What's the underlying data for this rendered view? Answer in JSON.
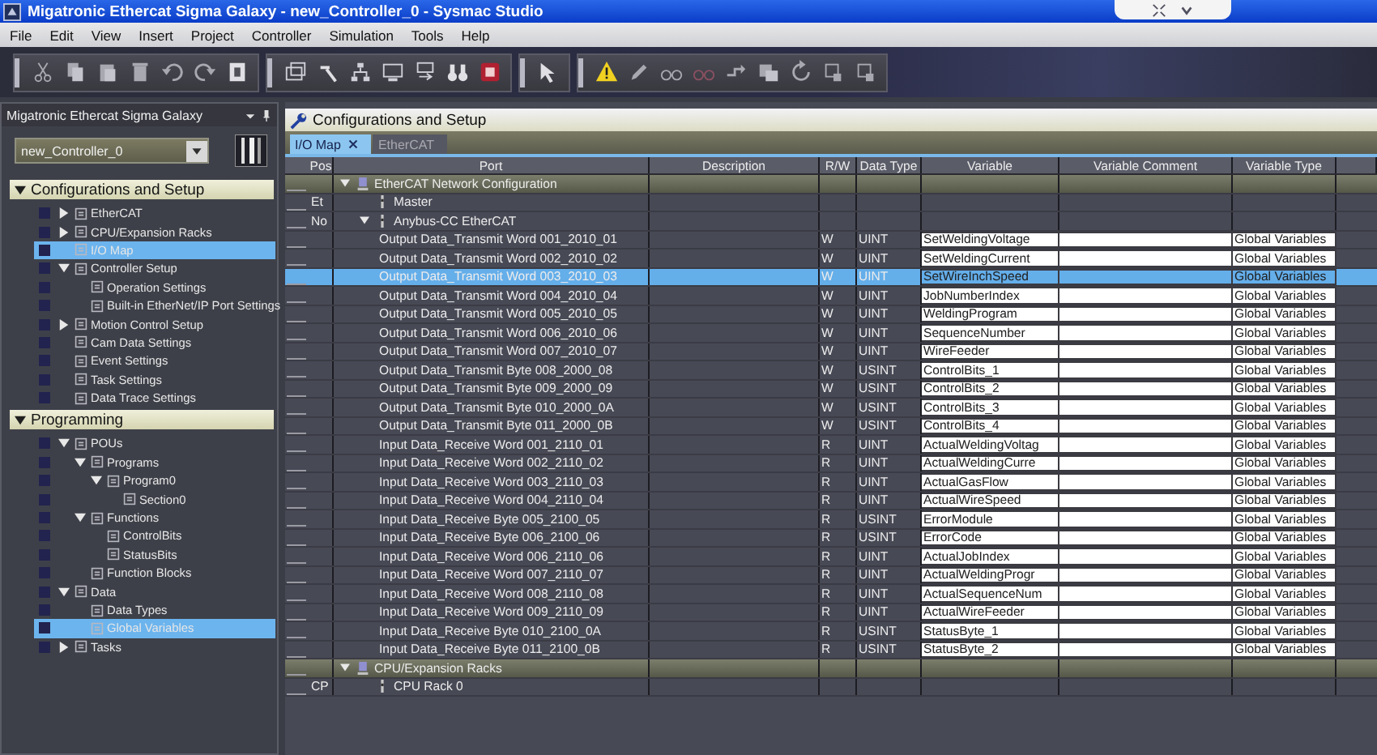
{
  "window": {
    "title": "Migatronic Ethercat Sigma Galaxy - new_Controller_0 - Sysmac Studio"
  },
  "menu": [
    "File",
    "Edit",
    "View",
    "Insert",
    "Project",
    "Controller",
    "Simulation",
    "Tools",
    "Help"
  ],
  "sidebar": {
    "title": "Migatronic Ethercat Sigma Galaxy",
    "controller": "new_Controller_0",
    "sections": [
      {
        "label": "Configurations and Setup",
        "expanded": true,
        "items": [
          {
            "label": "EtherCAT",
            "expanded": false,
            "selected": false
          },
          {
            "label": "CPU/Expansion Racks",
            "expanded": false,
            "selected": false
          },
          {
            "label": "I/O Map",
            "selected": true
          },
          {
            "label": "Controller Setup",
            "expanded": true,
            "selected": false,
            "children": [
              {
                "label": "Operation Settings",
                "selected": false
              },
              {
                "label": "Built-in EtherNet/IP Port Settings",
                "selected": false
              }
            ]
          },
          {
            "label": "Motion Control Setup",
            "expanded": false,
            "selected": false
          },
          {
            "label": "Cam Data Settings",
            "selected": false
          },
          {
            "label": "Event Settings",
            "selected": false
          },
          {
            "label": "Task Settings",
            "selected": false
          },
          {
            "label": "Data Trace Settings",
            "selected": false
          }
        ]
      },
      {
        "label": "Programming",
        "expanded": true,
        "items": [
          {
            "label": "POUs",
            "expanded": true,
            "selected": false,
            "children": [
              {
                "label": "Programs",
                "expanded": true,
                "selected": false,
                "children": [
                  {
                    "label": "Program0",
                    "expanded": true,
                    "selected": false,
                    "children": [
                      {
                        "label": "Section0",
                        "selected": false
                      }
                    ]
                  }
                ]
              },
              {
                "label": "Functions",
                "expanded": true,
                "selected": false,
                "children": [
                  {
                    "label": "ControlBits",
                    "selected": false
                  },
                  {
                    "label": "StatusBits",
                    "selected": false
                  }
                ]
              },
              {
                "label": "Function Blocks",
                "selected": false
              }
            ]
          },
          {
            "label": "Data",
            "expanded": true,
            "selected": false,
            "children": [
              {
                "label": "Data Types",
                "selected": false
              },
              {
                "label": "Global Variables",
                "selected": true
              }
            ]
          },
          {
            "label": "Tasks",
            "expanded": false,
            "selected": false
          }
        ]
      }
    ]
  },
  "editor": {
    "title": "Configurations and Setup",
    "tabs": [
      {
        "label": "I/O Map",
        "selected": true,
        "closable": true
      },
      {
        "label": "EtherCAT",
        "selected": false
      }
    ],
    "table": {
      "columns": [
        "Pos",
        "Port",
        "Description",
        "R/W",
        "Data Type",
        "Variable",
        "Variable Comment",
        "Variable Type"
      ],
      "rows": [
        {
          "kind": "group",
          "port": "EtherCAT Network Configuration",
          "expanded": true,
          "selected": false,
          "children": [
            {
              "kind": "device",
              "pos": "Et",
              "port": "Master",
              "selected": false
            },
            {
              "kind": "device",
              "pos": "No",
              "port": "Anybus-CC EtherCAT",
              "expanded": true,
              "selected": false,
              "children": [
                {
                  "kind": "port",
                  "port": "Output Data_Transmit Word 001_2010_01",
                  "rw": "W",
                  "type": "UINT",
                  "variable": "SetWeldingVoltage",
                  "variable_type": "Global Variables",
                  "selected": false
                },
                {
                  "kind": "port",
                  "port": "Output Data_Transmit Word 002_2010_02",
                  "rw": "W",
                  "type": "UINT",
                  "variable": "SetWeldingCurrent",
                  "variable_type": "Global Variables",
                  "selected": false
                },
                {
                  "kind": "port",
                  "port": "Output Data_Transmit Word 003_2010_03",
                  "rw": "W",
                  "type": "UINT",
                  "variable": "SetWireInchSpeed",
                  "variable_type": "Global Variables",
                  "selected": true
                },
                {
                  "kind": "port",
                  "port": "Output Data_Transmit Word 004_2010_04",
                  "rw": "W",
                  "type": "UINT",
                  "variable": "JobNumberIndex",
                  "variable_type": "Global Variables",
                  "selected": false
                },
                {
                  "kind": "port",
                  "port": "Output Data_Transmit Word 005_2010_05",
                  "rw": "W",
                  "type": "UINT",
                  "variable": "WeldingProgram",
                  "variable_type": "Global Variables",
                  "selected": false
                },
                {
                  "kind": "port",
                  "port": "Output Data_Transmit Word 006_2010_06",
                  "rw": "W",
                  "type": "UINT",
                  "variable": "SequenceNumber",
                  "variable_type": "Global Variables",
                  "selected": false
                },
                {
                  "kind": "port",
                  "port": "Output Data_Transmit Word 007_2010_07",
                  "rw": "W",
                  "type": "UINT",
                  "variable": "WireFeeder",
                  "variable_type": "Global Variables",
                  "selected": false
                },
                {
                  "kind": "port",
                  "port": "Output Data_Transmit Byte 008_2000_08",
                  "rw": "W",
                  "type": "USINT",
                  "variable": "ControlBits_1",
                  "variable_type": "Global Variables",
                  "selected": false
                },
                {
                  "kind": "port",
                  "port": "Output Data_Transmit Byte 009_2000_09",
                  "rw": "W",
                  "type": "USINT",
                  "variable": "ControlBits_2",
                  "variable_type": "Global Variables",
                  "selected": false
                },
                {
                  "kind": "port",
                  "port": "Output Data_Transmit Byte 010_2000_0A",
                  "rw": "W",
                  "type": "USINT",
                  "variable": "ControlBits_3",
                  "variable_type": "Global Variables",
                  "selected": false
                },
                {
                  "kind": "port",
                  "port": "Output Data_Transmit Byte 011_2000_0B",
                  "rw": "W",
                  "type": "USINT",
                  "variable": "ControlBits_4",
                  "variable_type": "Global Variables",
                  "selected": false
                },
                {
                  "kind": "port",
                  "port": "Input Data_Receive Word 001_2110_01",
                  "rw": "R",
                  "type": "UINT",
                  "variable": "ActualWeldingVoltag",
                  "variable_type": "Global Variables",
                  "selected": false
                },
                {
                  "kind": "port",
                  "port": "Input Data_Receive Word 002_2110_02",
                  "rw": "R",
                  "type": "UINT",
                  "variable": "ActualWeldingCurre",
                  "variable_type": "Global Variables",
                  "selected": false
                },
                {
                  "kind": "port",
                  "port": "Input Data_Receive Word 003_2110_03",
                  "rw": "R",
                  "type": "UINT",
                  "variable": "ActualGasFlow",
                  "variable_type": "Global Variables",
                  "selected": false
                },
                {
                  "kind": "port",
                  "port": "Input Data_Receive Word 004_2110_04",
                  "rw": "R",
                  "type": "UINT",
                  "variable": "ActualWireSpeed",
                  "variable_type": "Global Variables",
                  "selected": false
                },
                {
                  "kind": "port",
                  "port": "Input Data_Receive Byte 005_2100_05",
                  "rw": "R",
                  "type": "USINT",
                  "variable": "ErrorModule",
                  "variable_type": "Global Variables",
                  "selected": false
                },
                {
                  "kind": "port",
                  "port": "Input Data_Receive Byte 006_2100_06",
                  "rw": "R",
                  "type": "USINT",
                  "variable": "ErrorCode",
                  "variable_type": "Global Variables",
                  "selected": false
                },
                {
                  "kind": "port",
                  "port": "Input Data_Receive Word 006_2110_06",
                  "rw": "R",
                  "type": "UINT",
                  "variable": "ActualJobIndex",
                  "variable_type": "Global Variables",
                  "selected": false
                },
                {
                  "kind": "port",
                  "port": "Input Data_Receive Word 007_2110_07",
                  "rw": "R",
                  "type": "UINT",
                  "variable": "ActualWeldingProgr",
                  "variable_type": "Global Variables",
                  "selected": false
                },
                {
                  "kind": "port",
                  "port": "Input Data_Receive Word 008_2110_08",
                  "rw": "R",
                  "type": "UINT",
                  "variable": "ActualSequenceNum",
                  "variable_type": "Global Variables",
                  "selected": false
                },
                {
                  "kind": "port",
                  "port": "Input Data_Receive Word 009_2110_09",
                  "rw": "R",
                  "type": "UINT",
                  "variable": "ActualWireFeeder",
                  "variable_type": "Global Variables",
                  "selected": false
                },
                {
                  "kind": "port",
                  "port": "Input Data_Receive Byte 010_2100_0A",
                  "rw": "R",
                  "type": "USINT",
                  "variable": "StatusByte_1",
                  "variable_type": "Global Variables",
                  "selected": false
                },
                {
                  "kind": "port",
                  "port": "Input Data_Receive Byte 011_2100_0B",
                  "rw": "R",
                  "type": "USINT",
                  "variable": "StatusByte_2",
                  "variable_type": "Global Variables",
                  "selected": false
                }
              ]
            }
          ]
        },
        {
          "kind": "group",
          "port": "CPU/Expansion Racks",
          "expanded": true,
          "selected": false,
          "children": [
            {
              "kind": "device",
              "pos": "CP",
              "port": "CPU Rack 0",
              "selected": false
            }
          ]
        }
      ]
    }
  }
}
